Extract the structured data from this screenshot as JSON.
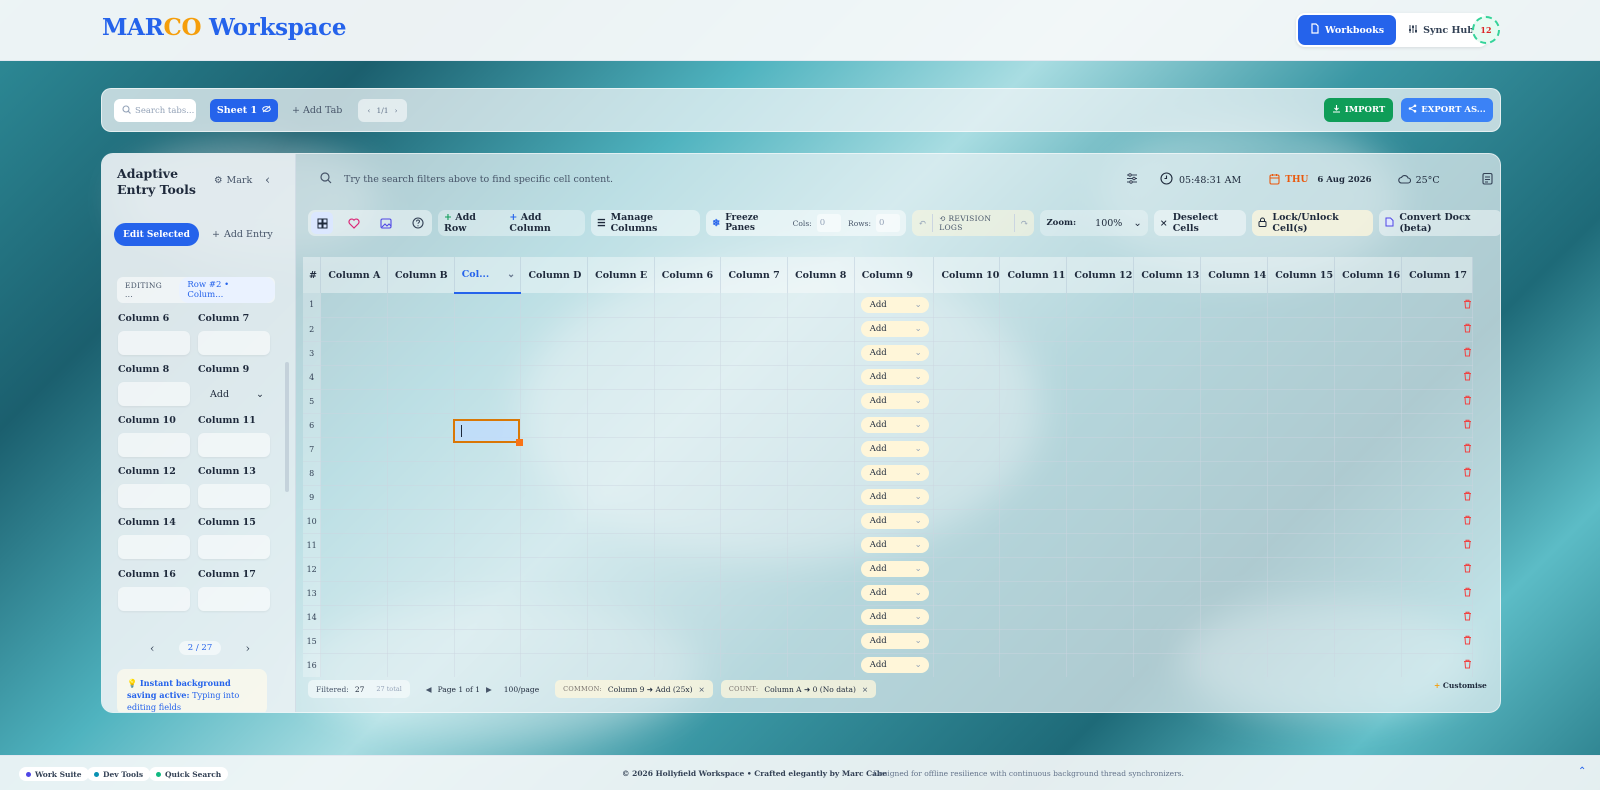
{
  "brand": {
    "part1": "MAR",
    "part2": "CO",
    "part3": " Workspace"
  },
  "nav": {
    "workbooks": "Workbooks",
    "sync_hub": "Sync Hub",
    "avatar": "12"
  },
  "tabbar": {
    "search_placeholder": "Search tabs...",
    "sheet": "Sheet 1",
    "add_tab": "Add Tab",
    "pager": "1/1",
    "import": "IMPORT",
    "export": "EXPORT AS..."
  },
  "sidebar": {
    "title": "Adaptive Entry Tools",
    "mark": "Mark",
    "edit_selected": "Edit Selected",
    "add_entry": "Add Entry",
    "editing_label": "EDITING ...",
    "editing_chip": "Row #2 • Colum...",
    "fields": [
      {
        "label": "Column 6"
      },
      {
        "label": "Column 7"
      },
      {
        "label": "Column 8"
      },
      {
        "label": "Column 9",
        "value": "Add"
      },
      {
        "label": "Column 10"
      },
      {
        "label": "Column 11"
      },
      {
        "label": "Column 12"
      },
      {
        "label": "Column 13"
      },
      {
        "label": "Column 14"
      },
      {
        "label": "Column 15"
      },
      {
        "label": "Column 16"
      },
      {
        "label": "Column 17"
      }
    ],
    "pager": "2 / 27",
    "note_title": "Instant background saving active:",
    "note_body": "Typing into editing fields"
  },
  "header": {
    "search_hint": "Try the search filters above to find specific cell content.",
    "time": "05:48:31 AM",
    "day": "THU",
    "date": "6 Aug 2026",
    "temp": "25°C"
  },
  "toolbar": {
    "add_row": "Add Row",
    "add_column": "Add Column",
    "manage_columns": "Manage Columns",
    "freeze_panes": "Freeze Panes",
    "cols_label": "Cols:",
    "cols_value": "0",
    "rows_label": "Rows:",
    "rows_value": "0",
    "revision_logs": "REVISION LOGS",
    "zoom_label": "Zoom:",
    "zoom_value": "100%",
    "deselect": "Deselect Cells",
    "lock": "Lock/Unlock Cell(s)",
    "convert": "Convert Docx (beta)"
  },
  "grid": {
    "corner": "#",
    "columns": [
      "Column A",
      "Column B",
      "Col...",
      "Column D",
      "Column E",
      "Column 6",
      "Column 7",
      "Column 8",
      "Column 9",
      "Column 10",
      "Column 11",
      "Column 12",
      "Column 13",
      "Column 14",
      "Column 15",
      "Column 16",
      "Column 17"
    ],
    "rows": [
      "1",
      "2",
      "3",
      "4",
      "5",
      "6",
      "7",
      "8",
      "9",
      "10",
      "11",
      "12",
      "13",
      "14",
      "15",
      "16"
    ],
    "dropdown_value": "Add"
  },
  "footer": {
    "filtered_label": "Filtered:",
    "filtered_value": "27",
    "total": "27 total",
    "page": "Page 1 of 1",
    "per_page": "100/page",
    "common_label": "COMMON:",
    "common_value": "Column 9 ➜ Add (25x)",
    "count_label": "COUNT:",
    "count_value": "Column A ➜ 0 (No data)",
    "customise": "Customise"
  },
  "bottom": {
    "chip1": "Work Suite",
    "chip2": "Dev Tools",
    "chip3": "Quick Search",
    "copyright": "© 2026 Hollyfield Workspace • Crafted elegantly by Marc Cabe",
    "tagline": "Designed for offline resilience with continuous background thread synchronizers."
  },
  "colors": {
    "accent": "#2563eb",
    "brand_orange": "#f59e0b",
    "import_green": "#0f9d58",
    "danger": "#ef4444"
  }
}
